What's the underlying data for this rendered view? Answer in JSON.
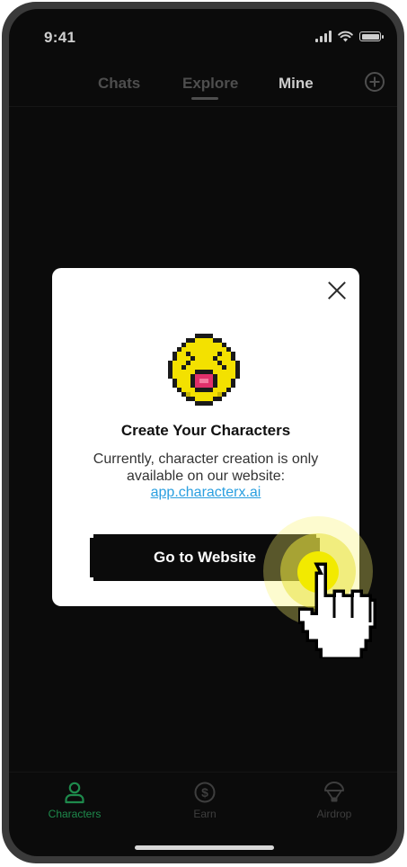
{
  "status_bar": {
    "time": "9:41"
  },
  "top_tabs": [
    {
      "label": "Chats"
    },
    {
      "label": "Explore"
    },
    {
      "label": "Mine"
    }
  ],
  "add_icon": "plus-circle-icon",
  "dialog": {
    "title": "Create Your Characters",
    "body": "Currently, character creation is only available on our website:",
    "link": "app.characterx.ai",
    "button_label": "Go to Website",
    "illustration": "pixel-emoji-shouting-face"
  },
  "bottom_nav": [
    {
      "label": "Characters",
      "icon": "person-icon",
      "active": true
    },
    {
      "label": "Earn",
      "icon": "dollar-coin-icon",
      "active": false
    },
    {
      "label": "Airdrop",
      "icon": "parachute-icon",
      "active": false
    }
  ],
  "colors": {
    "accent_green": "#1e8a4c",
    "link_blue": "#2a9fe0",
    "tap_yellow": "#f2ea00"
  }
}
